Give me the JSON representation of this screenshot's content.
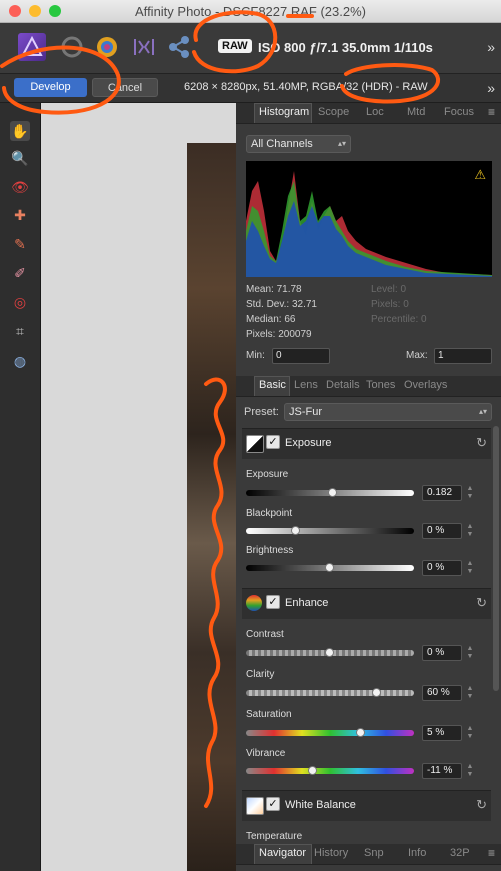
{
  "window": {
    "title": "Affinity Photo - DSCF8227.RAF (23.2%)"
  },
  "toolbar": {
    "raw_badge": "RAW",
    "exif": "ISO 800 ƒ/7.1 35.0mm 1/110s",
    "icons": [
      "persona-photo-icon",
      "persona-liquify-icon",
      "persona-develop-icon",
      "persona-tonemap-icon",
      "persona-export-icon"
    ]
  },
  "context": {
    "develop_label": "Develop",
    "cancel_label": "Cancel",
    "image_info": "6208 × 8280px, 51.40MP, RGBA/32 (HDR) - RAW"
  },
  "tools": [
    "hand-tool-icon",
    "zoom-tool-icon",
    "red-eye-tool-icon",
    "blemish-tool-icon",
    "brush-tool-icon",
    "erase-brush-tool-icon",
    "gradient-tool-icon",
    "crop-tool-icon",
    "white-balance-picker-icon"
  ],
  "top_tabs": [
    "Histogram",
    "Scope",
    "Loc",
    "Mtd",
    "Focus"
  ],
  "histogram": {
    "channel": "All Channels",
    "stats_left": {
      "mean": "Mean: 71.78",
      "stddev": "Std. Dev.: 32.71",
      "median": "Median: 66",
      "pixels": "Pixels: 200079"
    },
    "stats_right": {
      "level": "Level: 0",
      "pixels": "Pixels: 0",
      "percentile": "Percentile: 0"
    },
    "min_label": "Min:",
    "min_value": "0",
    "max_label": "Max:",
    "max_value": "1"
  },
  "mid_tabs": [
    "Basic",
    "Lens",
    "Details",
    "Tones",
    "Overlays"
  ],
  "preset": {
    "label": "Preset:",
    "value": "JS-Fur"
  },
  "sections": {
    "exposure": {
      "title": "Exposure",
      "sliders": [
        {
          "label": "Exposure",
          "value": "0.182"
        },
        {
          "label": "Blackpoint",
          "value": "0 %"
        },
        {
          "label": "Brightness",
          "value": "0 %"
        }
      ]
    },
    "enhance": {
      "title": "Enhance",
      "sliders": [
        {
          "label": "Contrast",
          "value": "0 %"
        },
        {
          "label": "Clarity",
          "value": "60 %"
        },
        {
          "label": "Saturation",
          "value": "5 %"
        },
        {
          "label": "Vibrance",
          "value": "-11 %"
        }
      ]
    },
    "white_balance": {
      "title": "White Balance",
      "first_label": "Temperature"
    }
  },
  "bottom_tabs": [
    "Navigator",
    "History",
    "Snp",
    "Info",
    "32P"
  ],
  "colors": {
    "accent": "#3b6fc9",
    "annotation": "#ff5a12"
  }
}
